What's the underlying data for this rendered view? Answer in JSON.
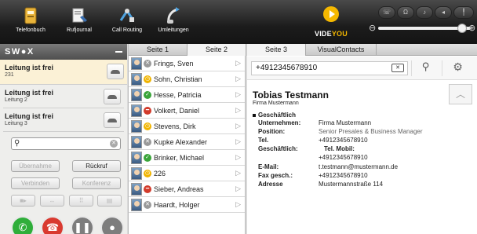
{
  "toolbar": {
    "buttons": [
      {
        "label": "Telefonbuch",
        "icon": "phonebook-icon"
      },
      {
        "label": "Rufjournal",
        "icon": "call-journal-icon"
      },
      {
        "label": "Call Routing",
        "icon": "call-routing-icon"
      },
      {
        "label": "Umleitungen",
        "icon": "forwarding-icon"
      }
    ],
    "brand": {
      "prefix": "VIDE",
      "suffix": "YOU"
    },
    "volume": {
      "minus": "⊖",
      "plus": "⊕",
      "level": 0.95
    }
  },
  "left": {
    "brand": "SW●X",
    "lines": [
      {
        "title": "Leitung ist frei",
        "sub": "231"
      },
      {
        "title": "Leitung ist frei",
        "sub": "Leitung 2"
      },
      {
        "title": "Leitung ist frei",
        "sub": "Leitung 3"
      }
    ],
    "search": {
      "value": ""
    },
    "actions": {
      "takeover": "Übernahme",
      "callback": "Rückruf",
      "connect": "Verbinden",
      "conference": "Konferenz"
    }
  },
  "middle": {
    "tabs": [
      "Seite 1",
      "Seite 2"
    ],
    "contacts": [
      {
        "name": "Frings, Sven",
        "status": "away"
      },
      {
        "name": "Sohn, Christian",
        "status": "busy-time"
      },
      {
        "name": "Hesse, Patricia",
        "status": "available"
      },
      {
        "name": "Volkert, Daniel",
        "status": "dnd"
      },
      {
        "name": "Stevens, Dirk",
        "status": "busy-time"
      },
      {
        "name": "Kupke Alexander",
        "status": "away"
      },
      {
        "name": "Brinker, Michael",
        "status": "available"
      },
      {
        "name": "226",
        "status": "busy-time"
      },
      {
        "name": "Sieber, Andreas",
        "status": "dnd"
      },
      {
        "name": "Haardt, Holger",
        "status": "away"
      }
    ]
  },
  "right": {
    "tabs": [
      "Seite 3",
      "VisualContacts"
    ],
    "number": "+4912345678910",
    "contact": {
      "name": "Tobias Testmann",
      "company": "Firma Mustermann",
      "section": "Geschäftlich",
      "details": [
        {
          "key": "Unternehmen:",
          "value": "Firma Mustermann"
        },
        {
          "key": "Position:",
          "value": "Senior Presales & Business Manager"
        },
        {
          "key": "Tel.",
          "value": "+4912345678910"
        },
        {
          "key": "Geschäftlich:",
          "value": "Tel. Mobil:"
        },
        {
          "key": "",
          "value": "+4912345678910"
        },
        {
          "key": "E-Mail:",
          "value": "t.testmann@mustermann.de"
        },
        {
          "key": "Fax gesch.:",
          "value": "+4912345678910"
        },
        {
          "key": "Adresse",
          "value": "Mustermannstraße 114"
        }
      ]
    }
  },
  "colors": {
    "available": "#3aa53a",
    "away": "#9a9a9a",
    "dnd": "#d23b2b",
    "busy-time": "#f0b400",
    "brand_yellow": "#f5b800",
    "accept_green": "#2fae3a",
    "hangup_red": "#d93a30"
  }
}
